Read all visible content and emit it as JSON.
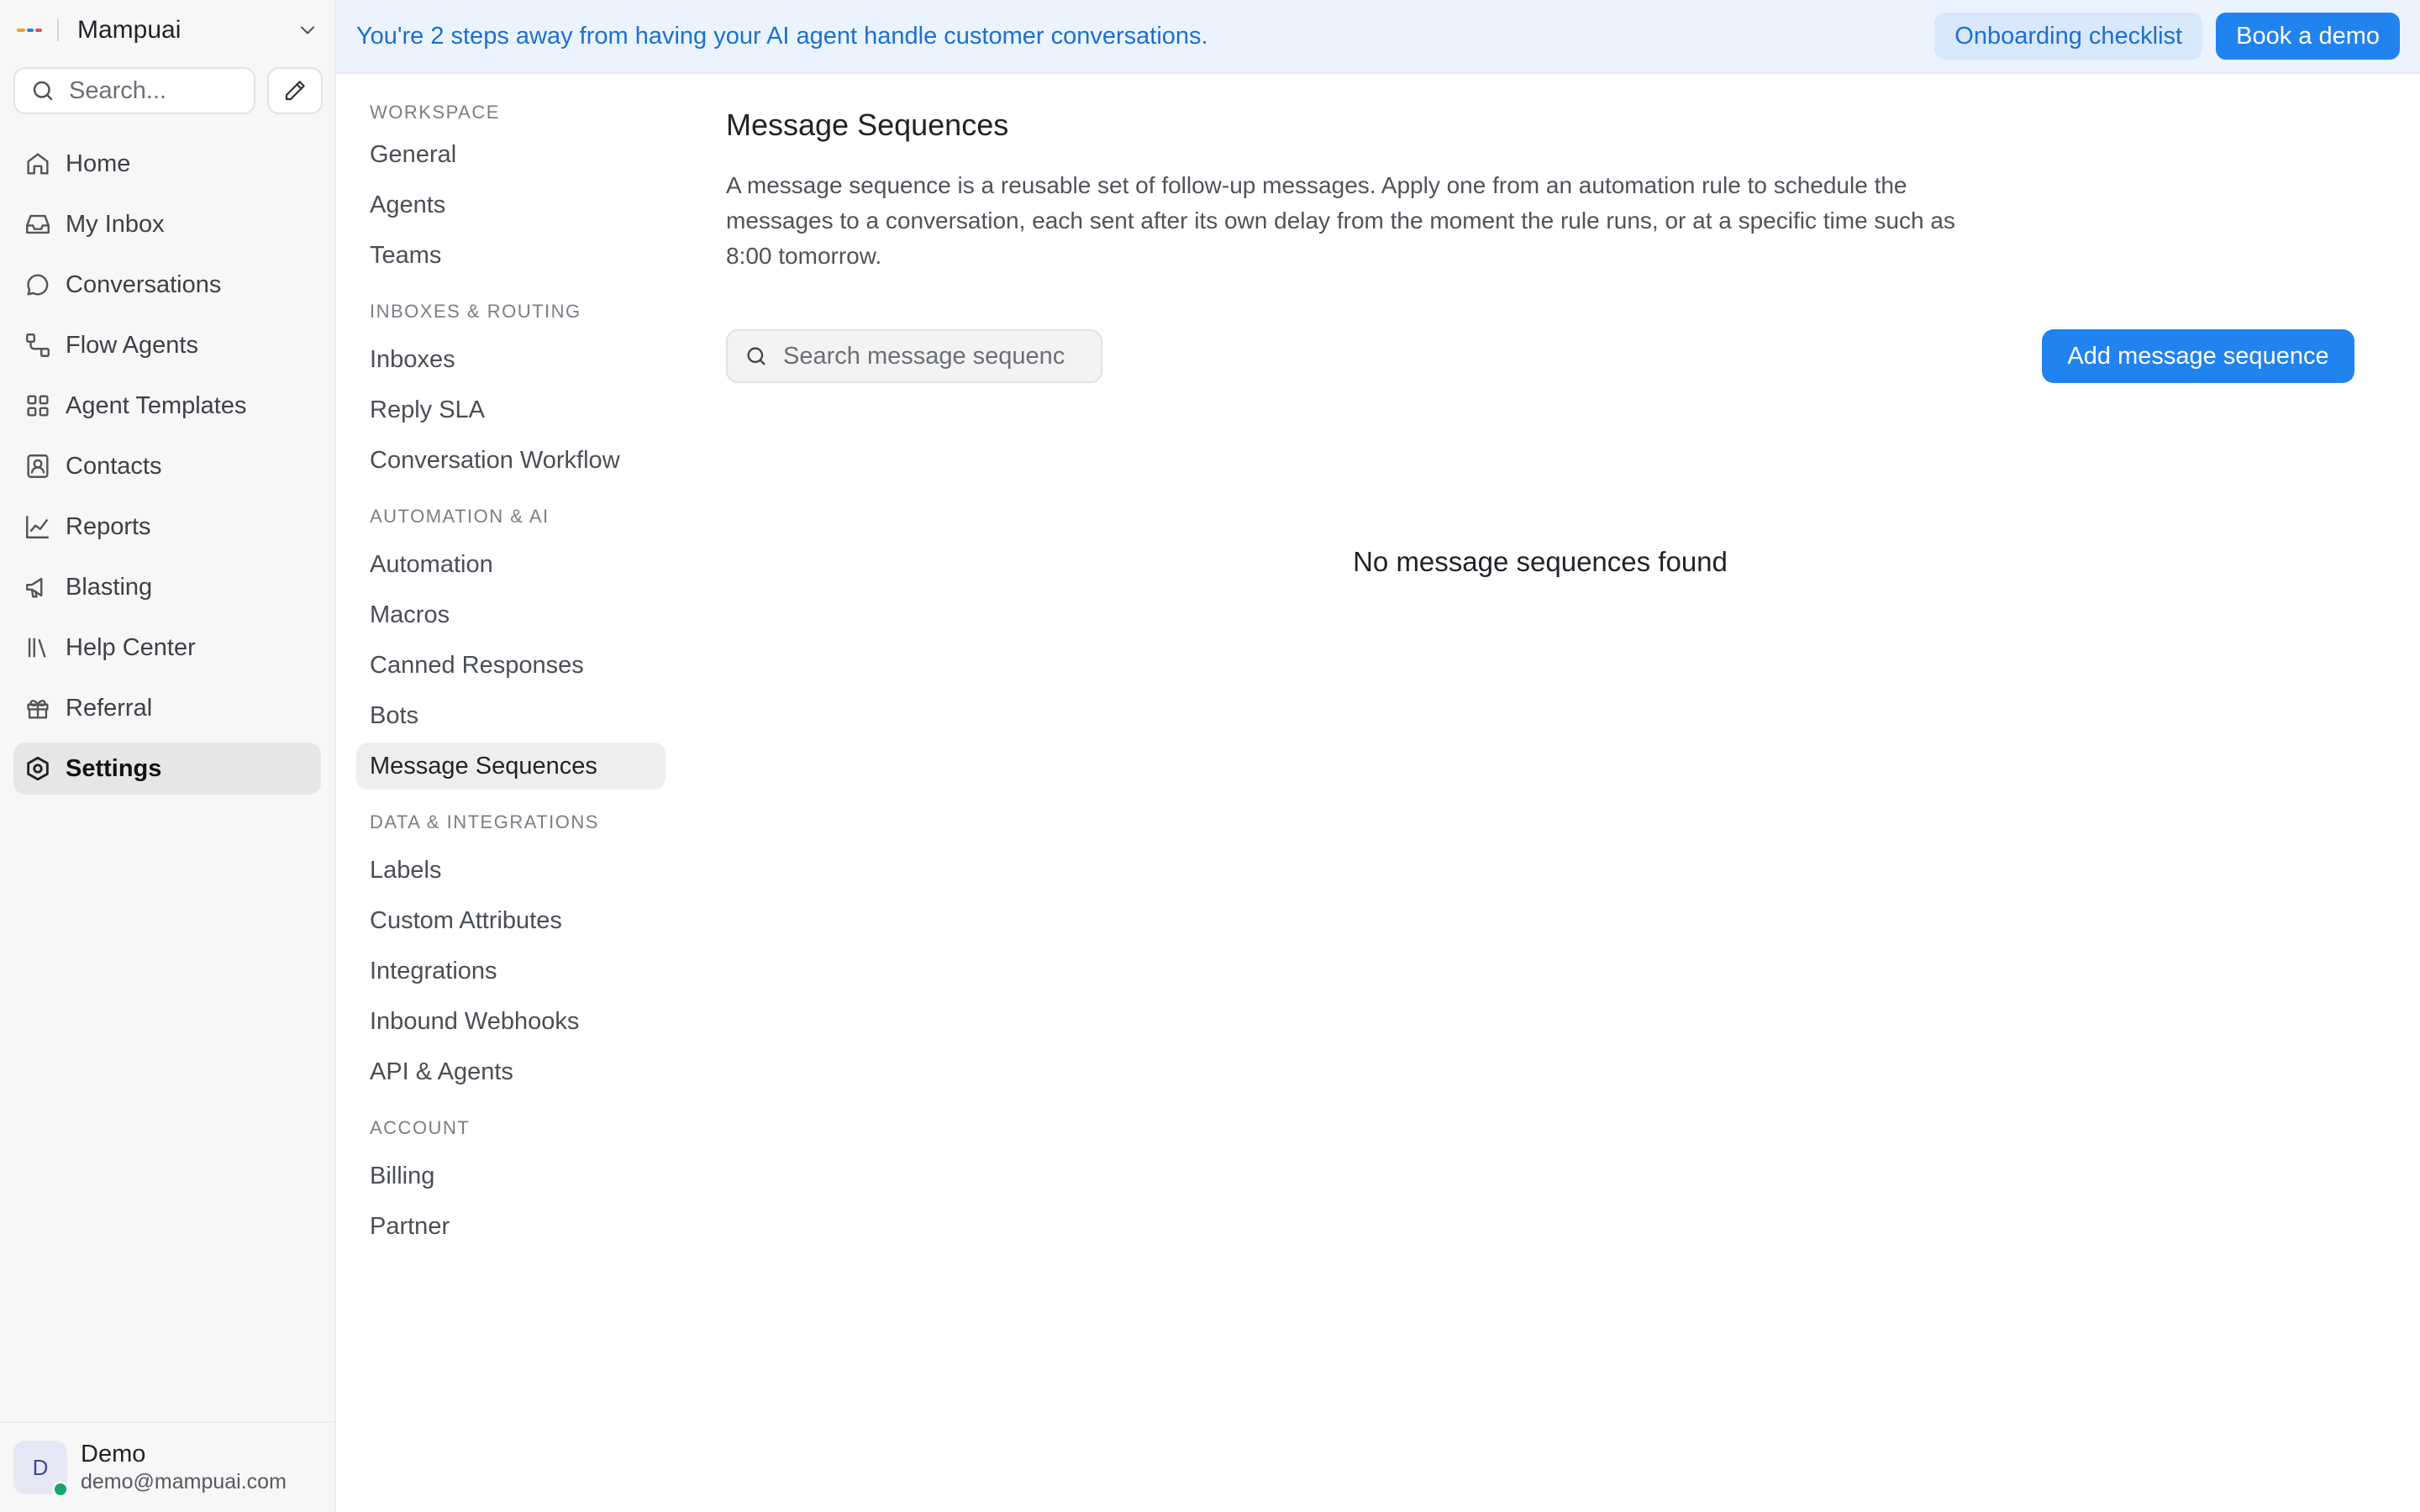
{
  "app": {
    "name": "Mampuai",
    "brand_colors": [
      "#f7a11a",
      "#2183f0",
      "#e84a5f"
    ]
  },
  "sidebar": {
    "search_placeholder": "Search...",
    "items": [
      {
        "label": "Home",
        "icon": "home-icon"
      },
      {
        "label": "My Inbox",
        "icon": "inbox-icon"
      },
      {
        "label": "Conversations",
        "icon": "chat-bubble-icon"
      },
      {
        "label": "Flow Agents",
        "icon": "flow-icon"
      },
      {
        "label": "Agent Templates",
        "icon": "grid-icon"
      },
      {
        "label": "Contacts",
        "icon": "contact-card-icon"
      },
      {
        "label": "Reports",
        "icon": "line-chart-icon"
      },
      {
        "label": "Blasting",
        "icon": "megaphone-icon"
      },
      {
        "label": "Help Center",
        "icon": "library-icon"
      },
      {
        "label": "Referral",
        "icon": "gift-icon"
      },
      {
        "label": "Settings",
        "icon": "settings-icon",
        "active": true
      }
    ],
    "user": {
      "initial": "D",
      "name": "Demo",
      "email": "demo@mampuai.com",
      "status_color": "#17a673"
    }
  },
  "banner": {
    "text": "You're 2 steps away from having your AI agent handle customer conversations.",
    "checklist_label": "Onboarding checklist",
    "demo_label": "Book a demo"
  },
  "settings_nav": {
    "groups": [
      {
        "title": "WORKSPACE",
        "items": [
          "General",
          "Agents",
          "Teams"
        ]
      },
      {
        "title": "INBOXES & ROUTING",
        "items": [
          "Inboxes",
          "Reply SLA",
          "Conversation Workflow"
        ]
      },
      {
        "title": "AUTOMATION & AI",
        "items": [
          "Automation",
          "Macros",
          "Canned Responses",
          "Bots",
          "Message Sequences"
        ]
      },
      {
        "title": "DATA & INTEGRATIONS",
        "items": [
          "Labels",
          "Custom Attributes",
          "Integrations",
          "Inbound Webhooks",
          "API & Agents"
        ]
      },
      {
        "title": "ACCOUNT",
        "items": [
          "Billing",
          "Partner"
        ]
      }
    ],
    "active": "Message Sequences"
  },
  "main": {
    "title": "Message Sequences",
    "description": "A message sequence is a reusable set of follow-up messages. Apply one from an automation rule to schedule the messages to a conversation, each sent after its own delay from the moment the rule runs, or at a specific time such as 8:00 tomorrow.",
    "search_placeholder": "Search message sequences",
    "add_label": "Add message sequence",
    "empty_text": "No message sequences found",
    "accent_color": "#2183f0"
  }
}
